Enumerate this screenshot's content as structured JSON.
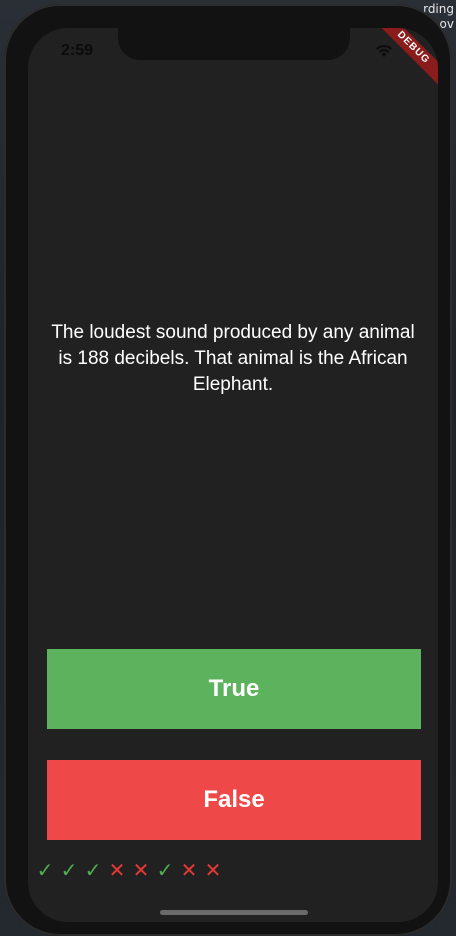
{
  "status_bar": {
    "time": "2:59"
  },
  "debug_banner": "DEBUG",
  "desktop_text": [
    "rding",
    "ov"
  ],
  "quiz": {
    "question": "The loudest sound produced by any animal is 188 decibels. That animal is the African Elephant.",
    "true_label": "True",
    "false_label": "False"
  },
  "score_keeper": [
    {
      "result": "correct",
      "icon": "check-icon",
      "glyph": "✓"
    },
    {
      "result": "correct",
      "icon": "check-icon",
      "glyph": "✓"
    },
    {
      "result": "correct",
      "icon": "check-icon",
      "glyph": "✓"
    },
    {
      "result": "wrong",
      "icon": "close-icon",
      "glyph": "✕"
    },
    {
      "result": "wrong",
      "icon": "close-icon",
      "glyph": "✕"
    },
    {
      "result": "correct",
      "icon": "check-icon",
      "glyph": "✓"
    },
    {
      "result": "wrong",
      "icon": "close-icon",
      "glyph": "✕"
    },
    {
      "result": "wrong",
      "icon": "close-icon",
      "glyph": "✕"
    }
  ],
  "colors": {
    "true_button": "#5cb25d",
    "false_button": "#ee4848",
    "correct": "#4caf50",
    "wrong": "#e53935",
    "background": "#212121"
  }
}
